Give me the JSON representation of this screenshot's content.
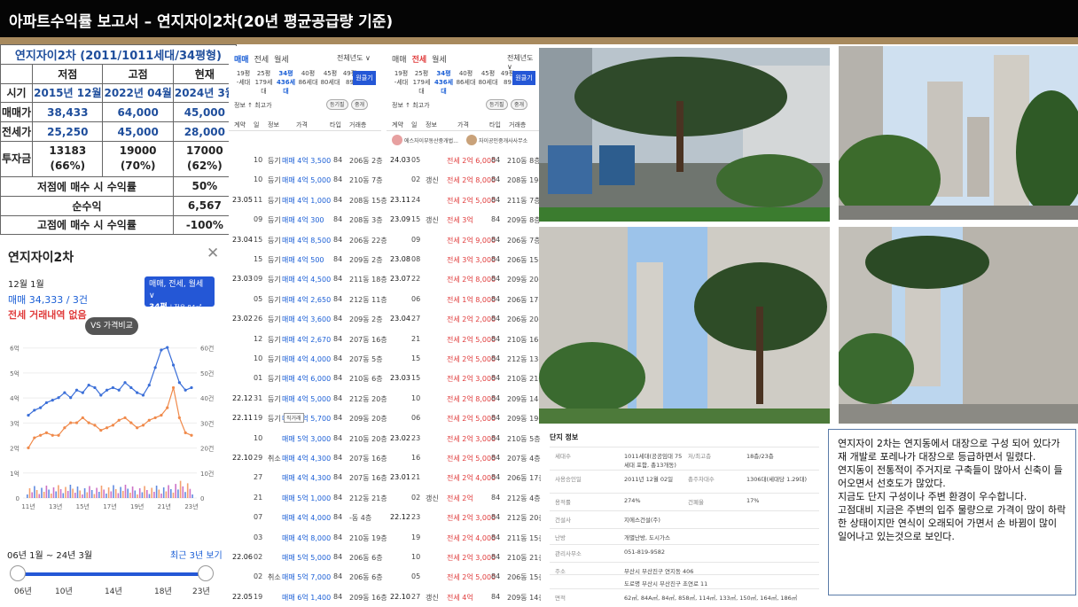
{
  "header": {
    "title": "아파트수익률 보고서 – 연지자이2차(20년 평균공급량 기준)"
  },
  "summary": {
    "title": "연지자이2차 (2011/1011세대/34평형)",
    "cols": [
      "저점",
      "고점",
      "현재"
    ],
    "rows": [
      {
        "label": "시기",
        "values": [
          "2015년 12월",
          "2022년 04월",
          "2024년 3월"
        ]
      },
      {
        "label": "매매가",
        "values": [
          "38,433",
          "64,000",
          "45,000"
        ]
      },
      {
        "label": "전세가",
        "values": [
          "25,250",
          "45,000",
          "28,000"
        ]
      },
      {
        "label": "투자금",
        "values": [
          [
            "13183",
            "(66%)"
          ],
          [
            "19000",
            "(70%)"
          ],
          [
            "17000",
            "(62%)"
          ]
        ]
      }
    ],
    "results": [
      {
        "label": "저점에 매수 시 수익률",
        "value": "50%"
      },
      {
        "label": "순수익",
        "value": "6,567"
      },
      {
        "label": "고점에 매수 시 수익률",
        "value": "-100%"
      }
    ]
  },
  "chart_card": {
    "title": "연지자이2차",
    "close": "✕",
    "month": "12월 1월",
    "trade_price": "매매 34,333 / 3건",
    "no_jeonse": "전세 거래내역 없음",
    "pill_top": "매매, 전세, 월세 ∨",
    "pill_size": "34평",
    "pill_area": "| 전용 84㎡",
    "vs_button": "VS 가격비교",
    "range_label": "06년 1월 ~ 24년 3월",
    "recent_3y": "최근 3년 보기",
    "slider_ticks": [
      "06년",
      "10년",
      "14년",
      "18년",
      "23년"
    ]
  },
  "chart_data": {
    "type": "line",
    "x": [
      "11년",
      "13년",
      "15년",
      "17년",
      "19년",
      "21년",
      "23년"
    ],
    "left_axis_ticks": [
      "0",
      "1억",
      "2억",
      "3억",
      "4억",
      "5억",
      "6억"
    ],
    "right_axis_ticks": [
      "0",
      "10건",
      "20건",
      "30건",
      "40건",
      "50건",
      "60건"
    ],
    "ylim": [
      0,
      6.5
    ],
    "grid": true,
    "series": [
      {
        "color": "#3b6fd8",
        "values": [
          3.3,
          3.5,
          3.6,
          3.8,
          3.9,
          4.0,
          4.2,
          4.0,
          4.3,
          4.2,
          4.5,
          4.4,
          4.1,
          4.3,
          4.4,
          4.3,
          4.6,
          4.4,
          4.2,
          4.1,
          4.5,
          5.2,
          5.9,
          6.0,
          5.3,
          4.6,
          4.3,
          4.4
        ]
      },
      {
        "color": "#f08a4b",
        "values": [
          2.0,
          2.4,
          2.5,
          2.6,
          2.5,
          2.5,
          2.8,
          3.0,
          3.0,
          3.2,
          3.0,
          2.9,
          2.7,
          2.8,
          2.9,
          3.1,
          3.2,
          3.0,
          2.8,
          2.9,
          3.1,
          3.2,
          3.3,
          3.6,
          4.4,
          3.2,
          2.6,
          2.5
        ]
      }
    ],
    "volume_series_colors": [
      "#3b6fd8",
      "#f08a4b",
      "#c04fb8"
    ]
  },
  "trade_list_1": {
    "tabs": [
      "매매",
      "전세",
      "월세"
    ],
    "year_filter": "전체년도 ∨",
    "size_tabs": [
      [
        "19평",
        "-세대"
      ],
      [
        "25평",
        "179세대"
      ],
      [
        "34평",
        "436세대"
      ],
      [
        "40평",
        "86세대"
      ],
      [
        "45평",
        "80세대"
      ],
      [
        "49평",
        "89"
      ]
    ],
    "apply": "원클기",
    "info": "정보  ↑ 최고가",
    "btns": [
      "등기필",
      "중개"
    ],
    "cols": [
      "계약",
      "일",
      "정보",
      "가격",
      "타입",
      "거래층"
    ],
    "rows": [
      [
        "",
        "10",
        "등기",
        "매매 4억 3,500",
        "84",
        "206동 2층"
      ],
      [
        "",
        "10",
        "등기",
        "매매 4억 5,000",
        "84",
        "210동 7층"
      ],
      [
        "23.05",
        "11",
        "등기",
        "매매 4억 1,000",
        "84",
        "208동 15층"
      ],
      [
        "",
        "09",
        "등기",
        "매매 4억 300",
        "84",
        "208동 3층"
      ],
      [
        "23.04",
        "15",
        "등기",
        "매매 4억 8,500",
        "84",
        "206동 22층"
      ],
      [
        "",
        "15",
        "등기",
        "매매 4억 500",
        "84",
        "209동 2층"
      ],
      [
        "23.03",
        "09",
        "등기",
        "매매 4억 4,500",
        "84",
        "211동 18층"
      ],
      [
        "",
        "05",
        "등기",
        "매매 4억 2,650",
        "84",
        "212동 11층"
      ],
      [
        "23.02",
        "26",
        "등기",
        "매매 4억 3,600",
        "84",
        "209동 2층"
      ],
      [
        "",
        "12",
        "등기",
        "매매 4억 2,670",
        "84",
        "207동 16층"
      ],
      [
        "",
        "10",
        "등기",
        "매매 4억 4,000",
        "84",
        "207동 5층"
      ],
      [
        "",
        "01",
        "등기",
        "매매 4억 6,000",
        "84",
        "210동 6층"
      ],
      [
        "22.12",
        "31",
        "등기",
        "매매 4억 5,000",
        "84",
        "212동 20층"
      ],
      [
        "22.11",
        "19",
        "등기",
        "매매 4억 5,700",
        "84",
        "209동 20층"
      ],
      [
        "",
        "10",
        "",
        "매매 5억 3,000",
        "84",
        "210동 20층"
      ],
      [
        "22.10",
        "29",
        "취소",
        "매매 4억 4,300",
        "84",
        "207동 16층"
      ],
      [
        "",
        "27",
        "",
        "매매 4억 4,300",
        "84",
        "207동 16층"
      ],
      [
        "",
        "21",
        "",
        "매매 5억 1,000",
        "84",
        "212동 21층"
      ],
      [
        "",
        "07",
        "",
        "매매 4억 4,000",
        "84",
        "-동 4층"
      ],
      [
        "",
        "03",
        "",
        "매매 4억 8,000",
        "84",
        "210동 19층"
      ],
      [
        "22.06",
        "02",
        "",
        "매매 5억 5,000",
        "84",
        "206동 6층"
      ],
      [
        "",
        "02",
        "취소",
        "매매 5억 7,000",
        "84",
        "206동 6층"
      ],
      [
        "22.05",
        "19",
        "",
        "매매 6억 1,400",
        "84",
        "209동 16층"
      ]
    ],
    "tag_note": "직거래"
  },
  "trade_list_2": {
    "tabs": [
      "매매",
      "전세",
      "월세"
    ],
    "year_filter": "전체년도 ∨",
    "size_tabs": [
      [
        "19평",
        "-세대"
      ],
      [
        "25평",
        "179세대"
      ],
      [
        "34평",
        "436세대"
      ],
      [
        "40평",
        "86세대"
      ],
      [
        "45평",
        "80세대"
      ],
      [
        "49평",
        "89"
      ]
    ],
    "apply": "원클기",
    "info": "정보  ↑ 최고가",
    "btns": [
      "등기필",
      "중개"
    ],
    "cols": [
      "계약",
      "일",
      "정보",
      "가격",
      "타입",
      "거래층"
    ],
    "agents": [
      "에스자이부동산중개법...",
      "자이공인중개사사무소"
    ],
    "rows": [
      [
        "24.03",
        "05",
        "",
        "전세 2억 6,000",
        "84",
        "210동 8층"
      ],
      [
        "",
        "02",
        "갱신",
        "전세 2억 8,000",
        "84",
        "208동 19층"
      ],
      [
        "23.11",
        "24",
        "",
        "전세 2억 5,000",
        "84",
        "211동 7층"
      ],
      [
        "23.09",
        "15",
        "갱신",
        "전세 3억",
        "84",
        "209동 8층"
      ],
      [
        "",
        "09",
        "",
        "전세 2억 9,000",
        "84",
        "206동 7층"
      ],
      [
        "23.08",
        "08",
        "",
        "전세 3억 3,000",
        "84",
        "206동 15층"
      ],
      [
        "23.07",
        "22",
        "",
        "전세 2억 8,000",
        "84",
        "209동 20층"
      ],
      [
        "",
        "06",
        "",
        "전세 1억 8,000",
        "84",
        "206동 17층"
      ],
      [
        "23.04",
        "27",
        "",
        "전세 2억 2,000",
        "84",
        "206동 20층"
      ],
      [
        "",
        "21",
        "",
        "전세 2억 5,000",
        "84",
        "210동 16층"
      ],
      [
        "",
        "15",
        "",
        "전세 2억 5,000",
        "84",
        "212동 13층"
      ],
      [
        "23.03",
        "15",
        "",
        "전세 2억 3,000",
        "84",
        "210동 21층"
      ],
      [
        "",
        "10",
        "",
        "전세 2억 8,000",
        "84",
        "209동 14층"
      ],
      [
        "",
        "06",
        "",
        "전세 2억 5,000",
        "84",
        "209동 19층"
      ],
      [
        "23.02",
        "23",
        "",
        "전세 2억 3,000",
        "84",
        "210동 5층"
      ],
      [
        "",
        "16",
        "",
        "전세 2억 5,000",
        "84",
        "207동 4층"
      ],
      [
        "23.01",
        "21",
        "",
        "전세 2억 4,000",
        "84",
        "206동 17층"
      ],
      [
        "",
        "02",
        "갱신",
        "전세 2억",
        "84",
        "212동 4층"
      ],
      [
        "22.12",
        "23",
        "",
        "전세 2억 3,000",
        "84",
        "212동 20층"
      ],
      [
        "",
        "19",
        "",
        "전세 2억 4,000",
        "84",
        "211동 15층"
      ],
      [
        "",
        "10",
        "",
        "전세 2억 3,000",
        "84",
        "210동 21층"
      ],
      [
        "",
        "05",
        "",
        "전세 2억 5,000",
        "84",
        "206동 15층"
      ],
      [
        "22.10",
        "27",
        "갱신",
        "전세 4억",
        "84",
        "209동 14층"
      ]
    ]
  },
  "complex_info": {
    "title": "단지 정보",
    "rows": [
      {
        "k1": "세대수",
        "v1": "1011세대(공공임대 75세대 포함, 총13개동)",
        "k2": "저/최고층",
        "v2": "18층/23층"
      },
      {
        "k1": "사용승인일",
        "v1": "2011년 12월 02일",
        "k2": "총주차대수",
        "v2": "1306대(세대당 1.29대)"
      },
      {
        "k1": "용적률",
        "v1": "274%",
        "k2": "건폐율",
        "v2": "17%"
      },
      {
        "k1": "건설사",
        "v1": "지에스건설(주)",
        "k2": "",
        "v2": ""
      },
      {
        "k1": "난방",
        "v1": "개별난방, 도시가스",
        "k2": "",
        "v2": ""
      },
      {
        "k1": "관리사무소",
        "v1": "051-819-9582",
        "k2": "",
        "v2": ""
      },
      {
        "k1": "주소",
        "v1": "부산시 부산진구 연지동 406",
        "k2": "",
        "v2": ""
      },
      {
        "k1": "",
        "v1": "도로명 부산시 부산진구 초연로 11",
        "k2": "",
        "v2": ""
      },
      {
        "k1": "면적",
        "v1": "62㎡, 84A㎡, 84㎡, 858㎡, 114㎡, 133㎡, 150㎡, 164㎡, 186㎡",
        "k2": "",
        "v2": ""
      }
    ]
  },
  "notes": {
    "paragraphs": [
      "연지자이 2차는 연지동에서 대장으로 구성 되어 있다가 재 개발로 포레나가 대장으로 등급하면서 밀렸다.",
      "연지동이 전통적이 주거지로 구축들이 많아서 신축이 들어오면서 선호도가 많았다.",
      "지금도  단지 구성이나 주변 환경이 우수합니다.",
      "고점대비 지금은 주변의 입주 물량으로 가격이 많이 하락한 상태이지만 연식이 오래되어 가면서 손 바뀜이 많이 일어나고 있는것으로 보인다."
    ]
  },
  "colors": {
    "header_bg": "#050505",
    "accent_line": "#a88a5e",
    "blue": "#1f4e9c",
    "price_blue": "#1b5fd6",
    "price_red": "#e03c3c",
    "button_blue": "#2457d6"
  }
}
